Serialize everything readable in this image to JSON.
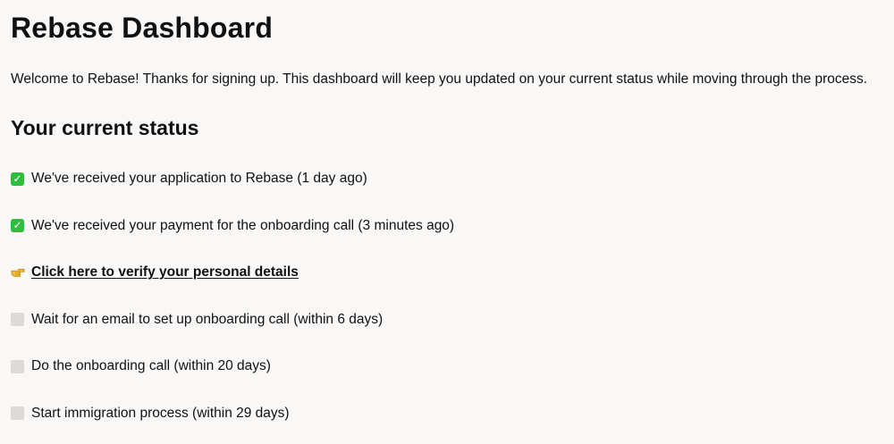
{
  "header": {
    "title": "Rebase Dashboard",
    "intro": "Welcome to Rebase! Thanks for signing up. This dashboard will keep you updated on your current status while moving through the process."
  },
  "status": {
    "heading": "Your current status",
    "steps": [
      {
        "icon": "check-mark-icon",
        "state": "done",
        "text": "We've received your application to Rebase (1 day ago)"
      },
      {
        "icon": "check-mark-icon",
        "state": "done",
        "text": "We've received your payment for the onboarding call (3 minutes ago)"
      },
      {
        "icon": "pointing-hand-icon",
        "state": "action",
        "text": "Click here to verify your personal details"
      },
      {
        "icon": "empty-checkbox-icon",
        "state": "pending",
        "text": "Wait for an email to set up onboarding call (within 6 days)"
      },
      {
        "icon": "empty-checkbox-icon",
        "state": "pending",
        "text": "Do the onboarding call (within 20 days)"
      },
      {
        "icon": "empty-checkbox-icon",
        "state": "pending",
        "text": "Start immigration process (within 29 days)"
      }
    ]
  },
  "colors": {
    "background": "#f9f8f7",
    "text": "#111111",
    "done": "#2ebd3c",
    "pending": "#dcdbda",
    "pointer": "#f4c12f"
  }
}
